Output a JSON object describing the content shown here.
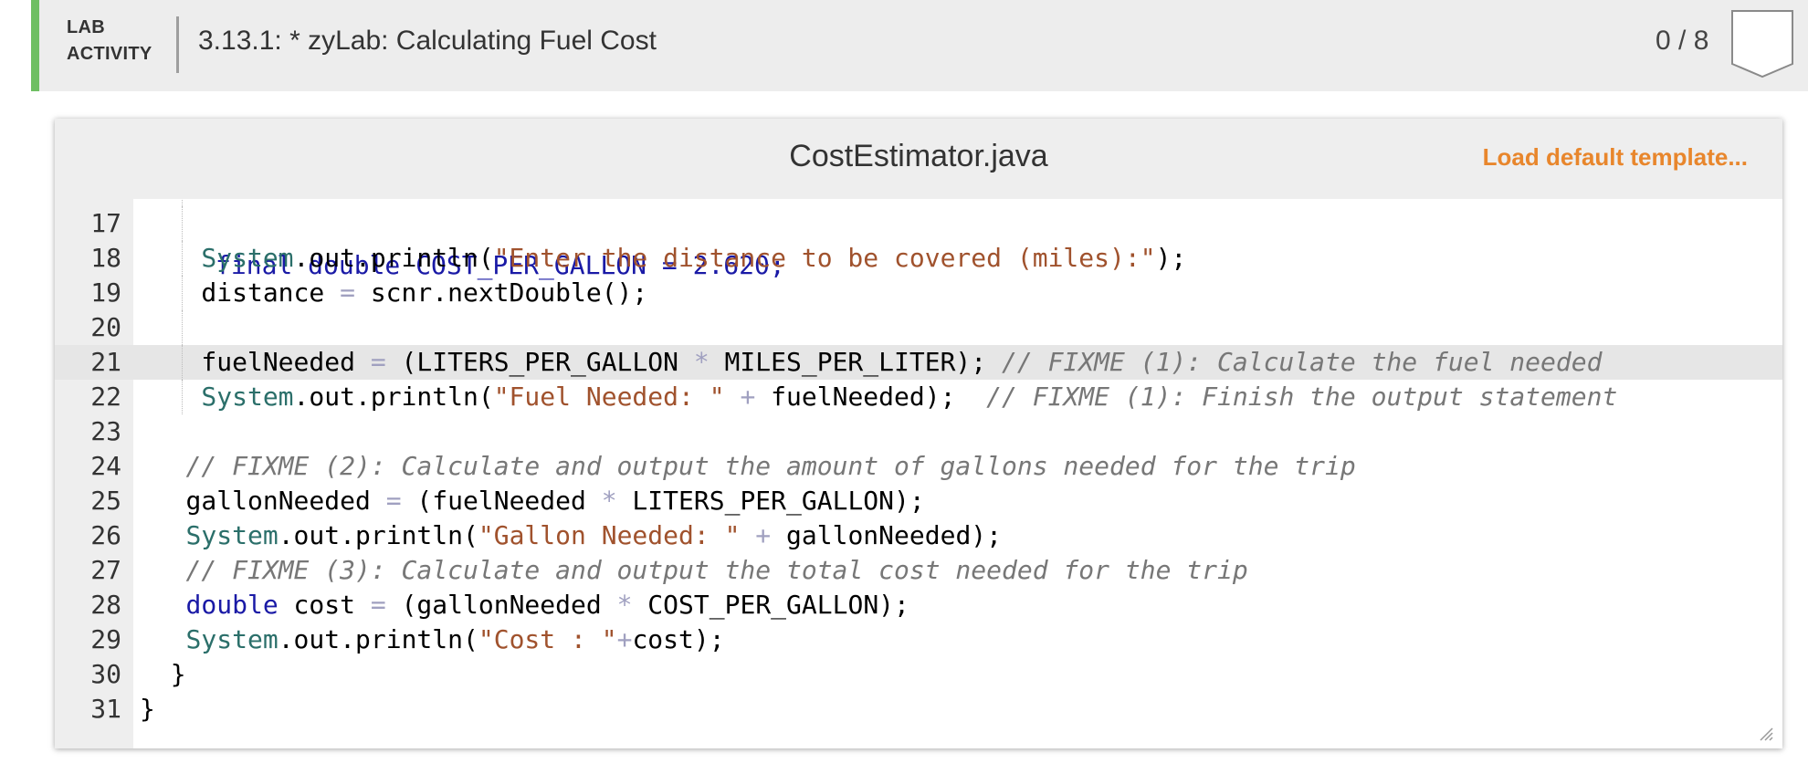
{
  "lab": {
    "tag_line1": "LAB",
    "tag_line2": "ACTIVITY",
    "title": "3.13.1: * zyLab: Calculating Fuel Cost",
    "score": "0 / 8"
  },
  "editor": {
    "file_name": "CostEstimator.java",
    "load_template_label": "Load default template...",
    "partial_line": "final double COST_PER_GALLON = 2.620;",
    "lines": [
      {
        "num": "17",
        "text": ""
      },
      {
        "num": "18",
        "text": "System.out.println(\"Enter the distance to be covered (miles):\");"
      },
      {
        "num": "19",
        "text": "distance = scnr.nextDouble();"
      },
      {
        "num": "20",
        "text": ""
      },
      {
        "num": "21",
        "text": "fuelNeeded = (LITERS_PER_GALLON * MILES_PER_LITER); // FIXME (1): Calculate the fuel needed"
      },
      {
        "num": "22",
        "text": "System.out.println(\"Fuel Needed: \" + fuelNeeded);  // FIXME (1): Finish the output statement"
      },
      {
        "num": "23",
        "text": ""
      },
      {
        "num": "24",
        "text": "// FIXME (2): Calculate and output the amount of gallons needed for the trip"
      },
      {
        "num": "25",
        "text": "gallonNeeded = (fuelNeeded * LITERS_PER_GALLON);"
      },
      {
        "num": "26",
        "text": "System.out.println(\"Gallon Needed: \" + gallonNeeded);"
      },
      {
        "num": "27",
        "text": "// FIXME (3): Calculate and output the total cost needed for the trip"
      },
      {
        "num": "28",
        "text": "double cost = (gallonNeeded * COST_PER_GALLON);"
      },
      {
        "num": "29",
        "text": "System.out.println(\"Cost : \"+cost);"
      },
      {
        "num": "30",
        "text": "}"
      },
      {
        "num": "31",
        "text": "}"
      }
    ],
    "active_line": "21"
  },
  "colors": {
    "accent_bar": "#6fbf63",
    "load_template": "#e8862c",
    "keyword": "#1a1aa6",
    "string": "#a0522d",
    "comment": "#777777"
  },
  "icons": {
    "score_badge": "shield-badge-icon",
    "resize_grip": "resize-grip-icon"
  }
}
